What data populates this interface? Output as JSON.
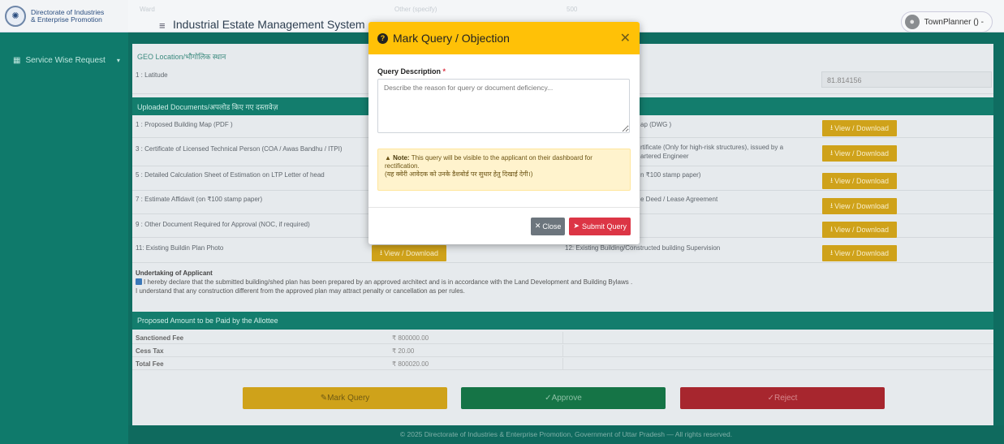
{
  "brand": {
    "line1": "Directorate of Industries",
    "line2": "& Enterprise Promotion"
  },
  "sidebar": {
    "items": [
      {
        "label": "Service Wise Request"
      }
    ]
  },
  "header": {
    "title": "Industrial Estate Management System",
    "ghost": [
      "Ward",
      "Other (specify)",
      "500"
    ],
    "user": "TownPlanner () -"
  },
  "geo": {
    "heading": "GEO Location/भौगोलिक स्थान",
    "latitude_label": "1 : Latitude",
    "longitude_value": "81.814156"
  },
  "documents": {
    "heading": "Uploaded Documents/अपलोड किए गए दस्तावेज़",
    "download_label": "View / Download",
    "left": [
      "1 : Proposed Building Map (PDF )",
      "3 : Certificate of Licensed Technical Person (COA / Awas Bandhu / ITPI)",
      "5 : Detailed Calculation Sheet of Estimation on LTP Letter of head",
      "7 : Estimate Affidavit (on ₹100 stamp paper)",
      "9 : Other Document Required for Approval (NOC, if required)",
      "11: Existing Buildin Plan Photo"
    ],
    "right": [
      "ap (DWG )",
      "rtificate (Only for high-risk structures), issued by a",
      "artered Engineer",
      "n ₹100 stamp paper)",
      "e Deed / Lease Agreement",
      "12: Existing Building/Constructed building Supervision"
    ]
  },
  "undertaking": {
    "title": "Undertaking of Applicant",
    "line1": "I hereby declare that the submitted building/shed plan has been prepared by an approved architect and is in accordance with the Land Development and Building Bylaws .",
    "line2": "I understand that any construction different from the approved plan may attract penalty or cancellation as per rules."
  },
  "fees": {
    "heading": "Proposed Amount to be Paid by the Allottee",
    "rows": [
      {
        "k": "Sanctioned Fee",
        "v": "₹ 800000.00"
      },
      {
        "k": "Cess Tax",
        "v": "₹ 20.00"
      },
      {
        "k": "Total Fee",
        "v": "₹ 800020.00"
      }
    ]
  },
  "actions": {
    "mark": "Mark Query",
    "approve": "Approve",
    "reject": "Reject"
  },
  "footer": "© 2025 Directorate of Industries & Enterprise Promotion, Government of Uttar Pradesh — All rights reserved.",
  "modal": {
    "title": "Mark Query / Objection",
    "field_label": "Query Description",
    "required_mark": "*",
    "placeholder": "Describe the reason for query or document deficiency...",
    "value": "",
    "note_prefix": "Note:",
    "note_text": "This query will be visible to the applicant on their dashboard for rectification.",
    "note_hindi": "(यह क्वेरी आवेदक को उनके डैशबोर्ड पर सुधार हेतु दिखाई देगी।)",
    "close_label": "Close",
    "submit_label": "Submit Query"
  },
  "colors": {
    "accent": "#ffc107",
    "danger": "#dc3545",
    "secondary": "#6c757d",
    "teal": "#137d6d"
  }
}
